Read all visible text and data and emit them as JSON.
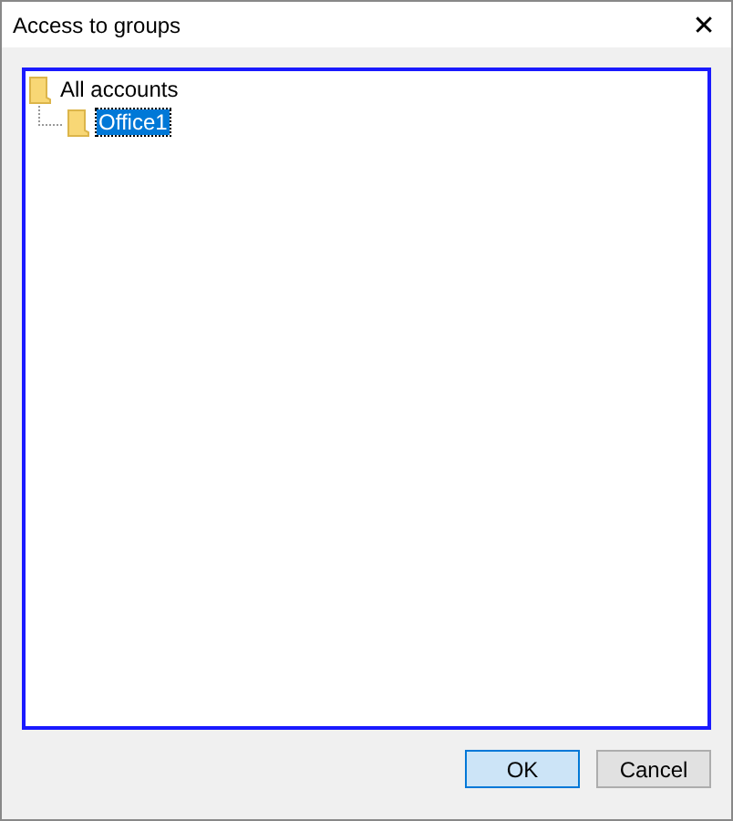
{
  "window": {
    "title": "Access to groups",
    "close": "✕"
  },
  "tree": [
    {
      "label": "All accounts",
      "selected": false,
      "children": [
        {
          "label": "Office1",
          "selected": true
        }
      ]
    }
  ],
  "buttons": [
    {
      "label": "OK",
      "default": true
    },
    {
      "label": "Cancel",
      "default": false
    }
  ]
}
